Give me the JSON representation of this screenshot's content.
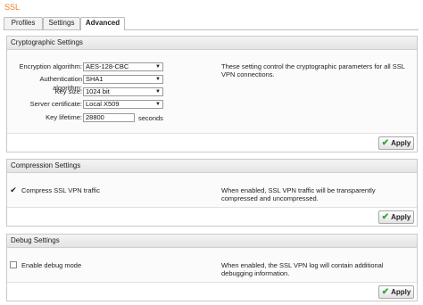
{
  "window": {
    "title": "SSL"
  },
  "tabs": [
    {
      "label": "Profiles"
    },
    {
      "label": "Settings"
    },
    {
      "label": "Advanced"
    }
  ],
  "crypto": {
    "header": "Cryptographic Settings",
    "encryption_label": "Encryption algorithm:",
    "encryption_value": "AES-128-CBC",
    "auth_label": "Authentication algorithm:",
    "auth_value": "SHA1",
    "keysize_label": "Key size:",
    "keysize_value": "1024 bit",
    "cert_label": "Server certificate:",
    "cert_value": "Local X509",
    "lifetime_label": "Key lifetime:",
    "lifetime_value": "28800",
    "lifetime_unit": "seconds",
    "description": "These setting control the cryptographic parameters for all SSL VPN connections.",
    "apply_label": "Apply"
  },
  "compression": {
    "header": "Compression Settings",
    "checkbox_label": "Compress SSL VPN traffic",
    "checked": true,
    "description": "When enabled, SSL VPN traffic will be transparently compressed and uncompressed.",
    "apply_label": "Apply"
  },
  "debug": {
    "header": "Debug Settings",
    "checkbox_label": "Enable debug mode",
    "checked": false,
    "description": "When enabled, the SSL VPN log will contain additional debugging information.",
    "apply_label": "Apply"
  }
}
